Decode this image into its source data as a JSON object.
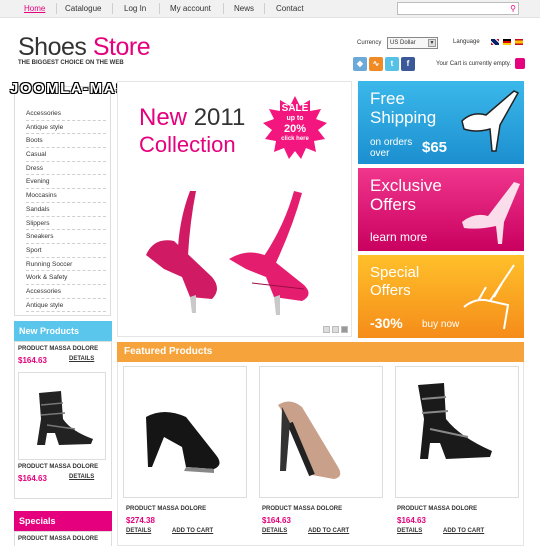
{
  "nav": {
    "items": [
      "Home",
      "Catalogue",
      "Log In",
      "My account",
      "News",
      "Contact"
    ]
  },
  "search": {
    "placeholder": ""
  },
  "brand": {
    "name_part1": "Shoes",
    "name_part2": "Store",
    "tagline": "THE BIGGEST CHOICE ON THE WEB"
  },
  "currency": {
    "label": "Currency",
    "selected": "US Dollar"
  },
  "language": {
    "label": "Language"
  },
  "cart": {
    "text": "Your Cart is currently empty."
  },
  "watermark": "JOOMLA-MASTER.ORG",
  "categories": [
    "Accessories",
    "Antique style",
    "Boots",
    "Casual",
    "Dress",
    "Evening",
    "Moccasins",
    "Sandals",
    "Slippers",
    "Sneakers",
    "Sport",
    "Running Soccer",
    "Work & Safety",
    "Accessories",
    "Antique style"
  ],
  "new_products": {
    "title": "New Products",
    "items": [
      {
        "name": "PRODUCT MASSA DOLORE",
        "price": "$164.63",
        "details": "DETAILS"
      },
      {
        "name": "PRODUCT MASSA DOLORE",
        "price": "$164.63",
        "details": "DETAILS"
      }
    ]
  },
  "specials": {
    "title": "Specials",
    "items": [
      {
        "name": "PRODUCT MASSA DOLORE"
      }
    ]
  },
  "hero": {
    "title_new": "New",
    "title_year": "2011",
    "title_line2": "Collection",
    "sale_line1": "SALE",
    "sale_line2": "up to",
    "sale_line3": "20%",
    "sale_line4": "click here"
  },
  "banners": {
    "free_shipping": {
      "line1": "Free",
      "line2": "Shipping",
      "sub1": "on orders",
      "sub2": "over",
      "amount": "$65"
    },
    "exclusive": {
      "line1": "Exclusive",
      "line2": "Offers",
      "sub": "learn more"
    },
    "special": {
      "line1": "Special",
      "line2": "Offers",
      "discount": "-30%",
      "sub": "buy now"
    }
  },
  "featured": {
    "title": "Featured Products",
    "items": [
      {
        "name": "PRODUCT MASSA DOLORE",
        "price": "$274.38",
        "details": "DETAILS",
        "cart": "ADD TO CART"
      },
      {
        "name": "PRODUCT MASSA DOLORE",
        "price": "$164.63",
        "details": "DETAILS",
        "cart": "ADD TO CART"
      },
      {
        "name": "PRODUCT MASSA DOLORE",
        "price": "$164.63",
        "details": "DETAILS",
        "cart": "ADD TO CART"
      }
    ]
  },
  "colors": {
    "accent": "#e5007d",
    "blue": "#2ea8e2",
    "orange": "#f6a33b",
    "sidebar_blue": "#5bc6ec"
  }
}
